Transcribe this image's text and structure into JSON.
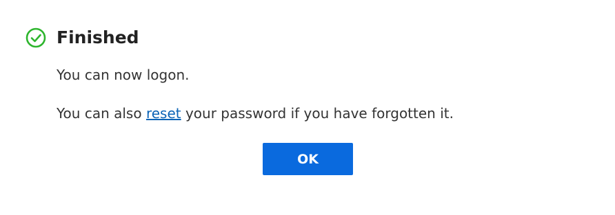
{
  "dialog": {
    "title": "Finished",
    "message_line1": "You can now logon.",
    "message_line2_before": "You can also ",
    "message_line2_link": "reset",
    "message_line2_after": " your password if you have forgotten it.",
    "ok_label": "OK",
    "icon": "check-circle-icon"
  },
  "colors": {
    "success": "#2db52d",
    "primary_button": "#0a6ade",
    "link": "#0b63b6"
  }
}
